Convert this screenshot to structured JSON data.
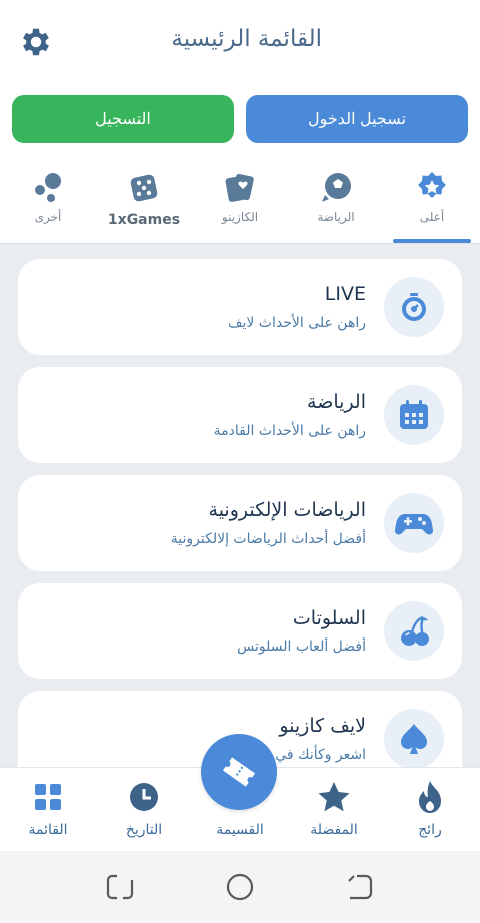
{
  "header": {
    "title": "القائمة الرئيسية",
    "settings_icon": "gear-icon"
  },
  "auth": {
    "register_label": "التسجيل",
    "login_label": "تسجيل الدخول"
  },
  "tabs": [
    {
      "label": "أعلى",
      "icon": "star-badge-icon",
      "active": true
    },
    {
      "label": "الرياضة",
      "icon": "soccer-ball-icon"
    },
    {
      "label": "الكازينو",
      "icon": "playing-cards-icon"
    },
    {
      "label": "1xGames",
      "icon": "dice-icon"
    },
    {
      "label": "أخرى",
      "icon": "bubbles-icon"
    }
  ],
  "menu": [
    {
      "title": "LIVE",
      "subtitle": "راهن على الأحداث لايف",
      "icon": "stopwatch-icon"
    },
    {
      "title": "الرياضة",
      "subtitle": "راهن على الأحداث القادمة",
      "icon": "calendar-icon"
    },
    {
      "title": "الرياضات الإلكترونية",
      "subtitle": "أفضل أحداث الرياضات إلالكترونية",
      "icon": "gamepad-icon"
    },
    {
      "title": "السلوتات",
      "subtitle": "أفضل ألعاب السلوتس",
      "icon": "cherries-icon"
    },
    {
      "title": "لايف كازينو",
      "subtitle": "اشعر وكأنك في",
      "icon": "spade-icon"
    }
  ],
  "bottom_nav": [
    {
      "label": "رائج",
      "icon": "flame-icon"
    },
    {
      "label": "المفضلة",
      "icon": "star-icon"
    },
    {
      "label": "القسيمة",
      "icon": "ticket-icon"
    },
    {
      "label": "التاريخ",
      "icon": "clock-icon"
    },
    {
      "label": "القائمة",
      "icon": "grid-icon"
    }
  ],
  "colors": {
    "accent": "#4a8ad8",
    "register": "#38b55c",
    "text_dark": "#1e3550",
    "text_sub": "#4a7aa6",
    "background": "#e9ecf1"
  }
}
